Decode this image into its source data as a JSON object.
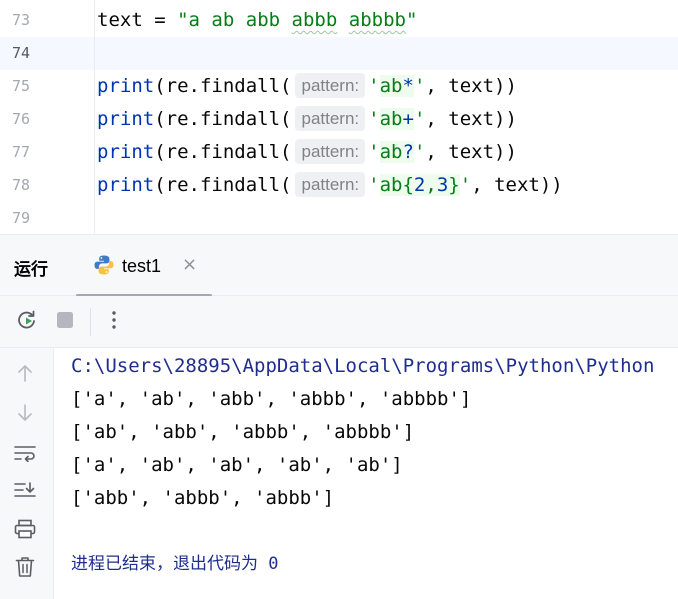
{
  "editor": {
    "line_numbers": [
      "73",
      "74",
      "75",
      "76",
      "77",
      "78",
      "79"
    ],
    "line73": {
      "var": "text",
      "op": " = ",
      "q1": "\"",
      "s1": "a ab ",
      "s2": "abb",
      "s3": " ",
      "s4": "abbb",
      "s5": " ",
      "s6": "abbbb",
      "q2": "\""
    },
    "calls": [
      {
        "fn": "print",
        "open": "(re.findall(",
        "hint": "pattern:",
        "q1": "'",
        "pat_a": "ab",
        "pat_b": "*",
        "pat_c": "",
        "pat_d": "",
        "pat_e": "",
        "q2": "'",
        "rest": ", text))"
      },
      {
        "fn": "print",
        "open": "(re.findall(",
        "hint": "pattern:",
        "q1": "'",
        "pat_a": "ab",
        "pat_b": "+",
        "pat_c": "",
        "pat_d": "",
        "pat_e": "",
        "q2": "'",
        "rest": ", text))"
      },
      {
        "fn": "print",
        "open": "(re.findall(",
        "hint": "pattern:",
        "q1": "'",
        "pat_a": "ab",
        "pat_b": "?",
        "pat_c": "",
        "pat_d": "",
        "pat_e": "",
        "q2": "'",
        "rest": ", text))"
      },
      {
        "fn": "print",
        "open": "(re.findall(",
        "hint": "pattern:",
        "q1": "'",
        "pat_a": "ab{",
        "pat_b": "2",
        "pat_c": ",",
        "pat_d": "3",
        "pat_e": "}",
        "q2": "'",
        "rest": ", text))"
      }
    ]
  },
  "tool_window": {
    "title": "运行",
    "tab_label": "test1",
    "tab_close": "×"
  },
  "icons": {
    "rerun": "rerun-icon",
    "stop": "stop-icon",
    "more": "more-vertical-icon",
    "up": "arrow-up-icon",
    "down": "arrow-down-icon",
    "wrap": "soft-wrap-icon",
    "scroll_end": "scroll-to-end-icon",
    "print": "print-icon",
    "trash": "trash-icon",
    "python": "python-icon"
  },
  "console": {
    "path": "C:\\Users\\28895\\AppData\\Local\\Programs\\Python\\Python",
    "outputs": [
      "['a', 'ab', 'abb', 'abbb', 'abbbb']",
      "['ab', 'abb', 'abbb', 'abbbb']",
      "['a', 'ab', 'ab', 'ab', 'ab']",
      "['abb', 'abbb', 'abbb']"
    ],
    "exit_message": "进程已结束，退出代码为 0"
  },
  "colors": {
    "keyword": "#0033b3",
    "string": "#067d17",
    "console_path": "#1f2d8f",
    "current_line": "#f5f8fe"
  }
}
